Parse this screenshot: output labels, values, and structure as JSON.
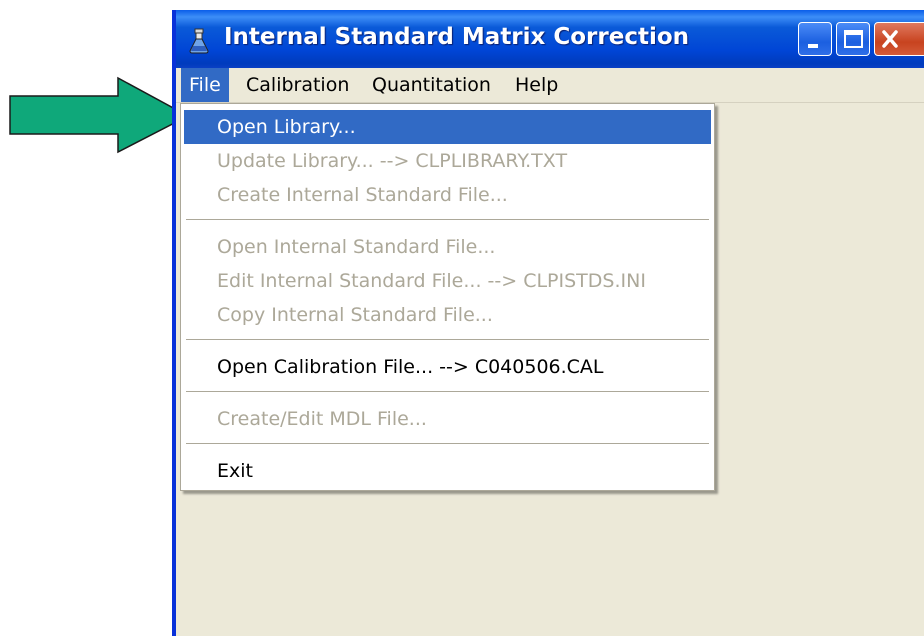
{
  "window": {
    "title": "Internal Standard Matrix Correction",
    "app_icon": "flask-icon",
    "controls": [
      "minimize-icon",
      "maximize-icon",
      "close-icon"
    ]
  },
  "menubar": {
    "items": [
      {
        "label": "File",
        "active": true
      },
      {
        "label": "Calibration"
      },
      {
        "label": "Quantitation"
      },
      {
        "label": "Help"
      }
    ]
  },
  "file_menu": {
    "open_library": "Open Library...",
    "update_library": "Update Library... --> CLPLIBRARY.TXT",
    "create_istd": "Create Internal Standard File...",
    "open_istd": "Open Internal Standard File...",
    "edit_istd": "Edit Internal Standard File... --> CLPISTDS.INI",
    "copy_istd": "Copy Internal Standard File...",
    "open_cal": "Open Calibration File... --> C040506.CAL",
    "create_mdl": "Create/Edit MDL File...",
    "exit": "Exit"
  },
  "annotation": {
    "pointer": "green-arrow-icon",
    "color": "#0fa87a"
  },
  "colors": {
    "title_bar": "#0045d6",
    "highlight": "#316ac5",
    "disabled_text": "#aca899",
    "window_bg": "#ece9d8"
  }
}
